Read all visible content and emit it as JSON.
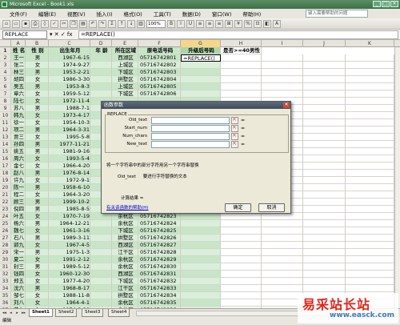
{
  "window": {
    "title": "Microsoft Excel - Book1.xls"
  },
  "menu": {
    "items": [
      "文件(F)",
      "编辑(E)",
      "视图(V)",
      "插入(I)",
      "格式(O)",
      "工具(T)",
      "数据(D)",
      "窗口(W)",
      "帮助(H)"
    ],
    "help_placeholder": "键入需要帮助的问题"
  },
  "toolbar": {
    "zoom": "100%"
  },
  "formula_bar": {
    "name_box": "REPLACE",
    "icons": "▾ ✕ ✓ fx",
    "formula": "=REPLACE()"
  },
  "columns": [
    "A",
    "B",
    "C",
    "D",
    "E",
    "F",
    "G",
    "H",
    "I",
    "J",
    "K"
  ],
  "headers": [
    "姓 名",
    "性 别",
    "出生年月",
    "年 龄",
    "所在区域",
    "原电话号码",
    "升级后号码",
    "是否>=40男性"
  ],
  "rows": [
    {
      "n": "2",
      "name": "王一",
      "sex": "男",
      "birth": "1967-6-15",
      "area": "西湖区",
      "phone": "05716742801",
      "upg": "=REPLACE()"
    },
    {
      "n": "3",
      "name": "张二",
      "sex": "女",
      "birth": "1974-9-27",
      "area": "上城区",
      "phone": "05716742802",
      "upg": ""
    },
    {
      "n": "4",
      "name": "林三",
      "sex": "男",
      "birth": "1953-2-21",
      "area": "下城区",
      "phone": "05716742803",
      "upg": ""
    },
    {
      "n": "5",
      "name": "胡四",
      "sex": "女",
      "birth": "1986-3-30",
      "area": "拱墅区",
      "phone": "05716742804",
      "upg": ""
    },
    {
      "n": "6",
      "name": "吴五",
      "sex": "男",
      "birth": "1953-8-3",
      "area": "上城区",
      "phone": "05716742805",
      "upg": ""
    },
    {
      "n": "7",
      "name": "章六",
      "sex": "女",
      "birth": "1959-5-12",
      "area": "下城区",
      "phone": "05716742806",
      "upg": ""
    },
    {
      "n": "8",
      "name": "陆七",
      "sex": "女",
      "birth": "1972-11-4",
      "area": "",
      "phone": "",
      "upg": ""
    },
    {
      "n": "9",
      "name": "苏八",
      "sex": "男",
      "birth": "1988-7-1",
      "area": "",
      "phone": "",
      "upg": ""
    },
    {
      "n": "10",
      "name": "韩九",
      "sex": "女",
      "birth": "1973-4-17",
      "area": "",
      "phone": "",
      "upg": ""
    },
    {
      "n": "11",
      "name": "徐一",
      "sex": "女",
      "birth": "1954-10-3",
      "area": "",
      "phone": "",
      "upg": ""
    },
    {
      "n": "12",
      "name": "项二",
      "sex": "男",
      "birth": "1964-3-31",
      "area": "",
      "phone": "",
      "upg": ""
    },
    {
      "n": "13",
      "name": "贾三",
      "sex": "女",
      "birth": "1995-5-8",
      "area": "",
      "phone": "",
      "upg": ""
    },
    {
      "n": "14",
      "name": "孙四",
      "sex": "男",
      "birth": "1977-11-21",
      "area": "",
      "phone": "",
      "upg": ""
    },
    {
      "n": "15",
      "name": "姚五",
      "sex": "男",
      "birth": "1981-9-16",
      "area": "",
      "phone": "",
      "upg": ""
    },
    {
      "n": "16",
      "name": "周六",
      "sex": "女",
      "birth": "1993-5-4",
      "area": "",
      "phone": "",
      "upg": ""
    },
    {
      "n": "17",
      "name": "金七",
      "sex": "女",
      "birth": "1966-4-20",
      "area": "",
      "phone": "",
      "upg": ""
    },
    {
      "n": "18",
      "name": "赵八",
      "sex": "男",
      "birth": "1976-8-14",
      "area": "",
      "phone": "",
      "upg": ""
    },
    {
      "n": "19",
      "name": "许九",
      "sex": "女",
      "birth": "1972-9-1",
      "area": "",
      "phone": "",
      "upg": ""
    },
    {
      "n": "20",
      "name": "陈一",
      "sex": "男",
      "birth": "1958-6-10",
      "area": "",
      "phone": "",
      "upg": ""
    },
    {
      "n": "21",
      "name": "程二",
      "sex": "女",
      "birth": "1964-3-20",
      "area": "",
      "phone": "",
      "upg": ""
    },
    {
      "n": "22",
      "name": "顾三",
      "sex": "男",
      "birth": "1999-10-2",
      "area": "",
      "phone": "",
      "upg": ""
    },
    {
      "n": "23",
      "name": "倪四",
      "sex": "男",
      "birth": "1985-8-5",
      "area": "",
      "phone": "",
      "upg": ""
    },
    {
      "n": "24",
      "name": "叶五",
      "sex": "女",
      "birth": "1970-7-19",
      "area": "余杭区",
      "phone": "05716742823",
      "upg": ""
    },
    {
      "n": "25",
      "name": "杨六",
      "sex": "男",
      "birth": "1964-12-21",
      "area": "余杭区",
      "phone": "05716742824",
      "upg": ""
    },
    {
      "n": "26",
      "name": "魏七",
      "sex": "女",
      "birth": "1961-3-16",
      "area": "下城区",
      "phone": "05716742825",
      "upg": ""
    },
    {
      "n": "27",
      "name": "石八",
      "sex": "男",
      "birth": "1989-3-11",
      "area": "拱墅区",
      "phone": "05716742826",
      "upg": ""
    },
    {
      "n": "28",
      "name": "郭九",
      "sex": "女",
      "birth": "1967-4-5",
      "area": "西湖区",
      "phone": "05716742827",
      "upg": ""
    },
    {
      "n": "29",
      "name": "宋一",
      "sex": "男",
      "birth": "1975-1-3",
      "area": "江干区",
      "phone": "05716742828",
      "upg": ""
    },
    {
      "n": "30",
      "name": "夏二",
      "sex": "女",
      "birth": "1991-2-12",
      "area": "余杭区",
      "phone": "05716742829",
      "upg": ""
    },
    {
      "n": "31",
      "name": "封三",
      "sex": "男",
      "birth": "1989-5-12",
      "area": "余杭区",
      "phone": "05716742830",
      "upg": ""
    },
    {
      "n": "32",
      "name": "钱四",
      "sex": "女",
      "birth": "1960-12-30",
      "area": "西湖区",
      "phone": "05716742831",
      "upg": ""
    },
    {
      "n": "33",
      "name": "郑五",
      "sex": "女",
      "birth": "1977-4-20",
      "area": "下城区",
      "phone": "05716742832",
      "upg": ""
    },
    {
      "n": "34",
      "name": "沈六",
      "sex": "男",
      "birth": "1968-8-17",
      "area": "江干区",
      "phone": "05716742833",
      "upg": ""
    },
    {
      "n": "35",
      "name": "邹七",
      "sex": "女",
      "birth": "1988-11-8",
      "area": "拱墅区",
      "phone": "05716742834",
      "upg": ""
    },
    {
      "n": "36",
      "name": "刘八",
      "sex": "女",
      "birth": "1964-4-1",
      "area": "余杭区",
      "phone": "05716742835",
      "upg": ""
    },
    {
      "n": "37",
      "name": "董九",
      "sex": "女",
      "birth": "1974-3-29",
      "area": "余杭区",
      "phone": "05716742836",
      "upg": ""
    }
  ],
  "dialog": {
    "title": "函数参数",
    "function_name": "REPLACE",
    "args": [
      "Old_text",
      "Start_num",
      "Num_chars",
      "New_text"
    ],
    "equals": "=",
    "description": "将一个字符串中的部分字符用另一个字符串替换",
    "arg_help_name": "Old_text",
    "arg_help_text": "要进行字符替换的文本",
    "result_label": "计算结果 =",
    "help_link": "有关该函数的帮助(H)",
    "ok": "确定",
    "cancel": "取消"
  },
  "sheets": {
    "nav": [
      "◂◂",
      "◂",
      "▸",
      "▸▸"
    ],
    "tabs": [
      "Sheet1",
      "Sheet2",
      "Sheet3",
      "Sheet4"
    ]
  },
  "status": {
    "text": "编辑"
  },
  "watermark": {
    "title": "易采站长站",
    "url": "www.easck.com"
  }
}
